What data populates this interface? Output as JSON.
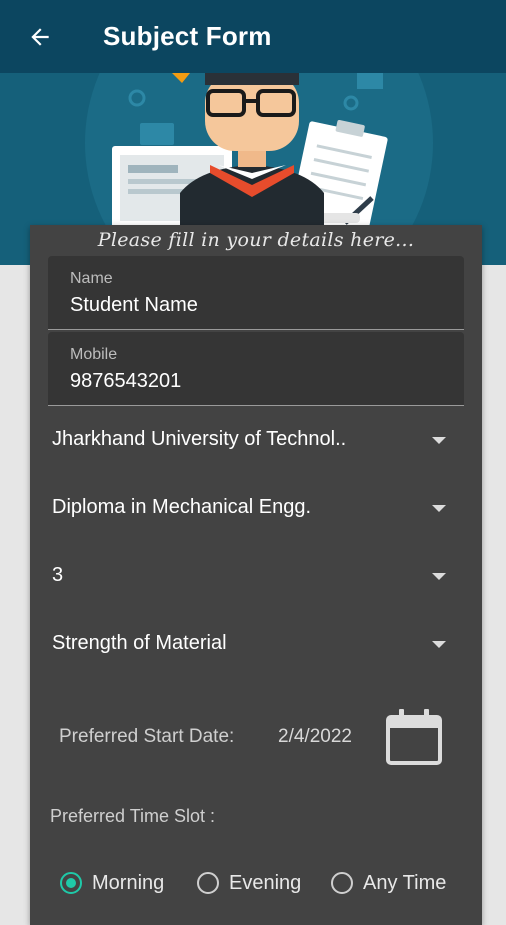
{
  "appbar": {
    "title": "Subject Form"
  },
  "form": {
    "heading": "Please fill in your details here...",
    "name": {
      "label": "Name",
      "value": "Student Name"
    },
    "mobile": {
      "label": "Mobile",
      "value": "9876543201"
    },
    "university": {
      "selected": "Jharkhand University of Technol.."
    },
    "course": {
      "selected": "Diploma in Mechanical Engg."
    },
    "semester": {
      "selected": "3"
    },
    "subject": {
      "selected": "Strength of Material"
    },
    "start_date": {
      "label": "Preferred Start Date:",
      "value": "2/4/2022"
    },
    "time_slot": {
      "label": "Preferred Time Slot :",
      "options": [
        "Morning",
        "Evening",
        "Any Time"
      ],
      "selected": "Morning"
    }
  },
  "colors": {
    "appbar": "#0c4660",
    "hero": "#15607a",
    "card": "#434343",
    "accent": "#1fc9a8"
  },
  "icons": [
    "back-arrow-icon",
    "dropdown-arrow-icon",
    "calendar-icon",
    "radio-icon"
  ]
}
